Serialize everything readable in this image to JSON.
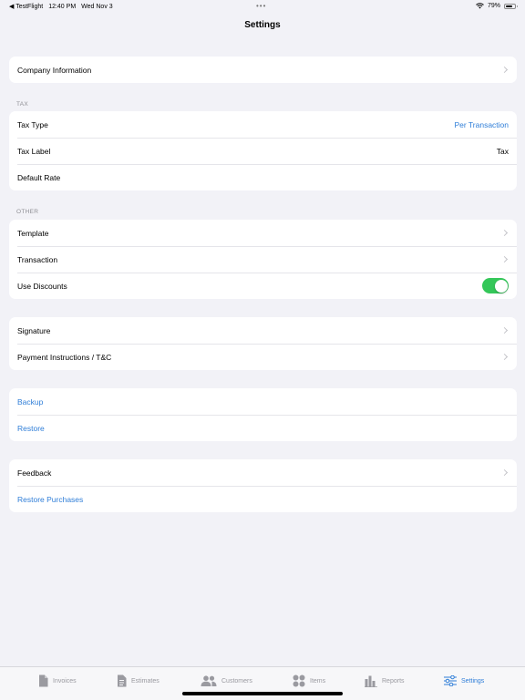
{
  "status_bar": {
    "back_app": "TestFlight",
    "time": "12:40 PM",
    "date": "Wed Nov 3",
    "dots": "•••",
    "battery": "79%",
    "battery_level": 0.79
  },
  "nav": {
    "title": "Settings"
  },
  "groups": {
    "company": {
      "label": "Company Information"
    },
    "tax": {
      "header": "TAX",
      "tax_type_label": "Tax Type",
      "tax_type_value": "Per Transaction",
      "tax_label_label": "Tax Label",
      "tax_label_value": "Tax",
      "default_rate_label": "Default Rate"
    },
    "other": {
      "header": "OTHER",
      "template_label": "Template",
      "transaction_label": "Transaction",
      "use_discounts_label": "Use Discounts",
      "use_discounts_on": true
    },
    "signature": {
      "signature_label": "Signature",
      "payment_label": "Payment Instructions / T&C"
    },
    "backup": {
      "backup_label": "Backup",
      "restore_label": "Restore"
    },
    "feedback": {
      "feedback_label": "Feedback",
      "restore_purchases_label": "Restore Purchases"
    }
  },
  "tabs": {
    "invoices": "Invoices",
    "estimates": "Estimates",
    "customers": "Customers",
    "items": "Items",
    "reports": "Reports",
    "settings": "Settings",
    "active": "settings"
  },
  "colors": {
    "accent": "#2f7ed8",
    "toggle_on": "#34c759",
    "background": "#f2f2f7",
    "tab_inactive": "#9a9aa0"
  }
}
